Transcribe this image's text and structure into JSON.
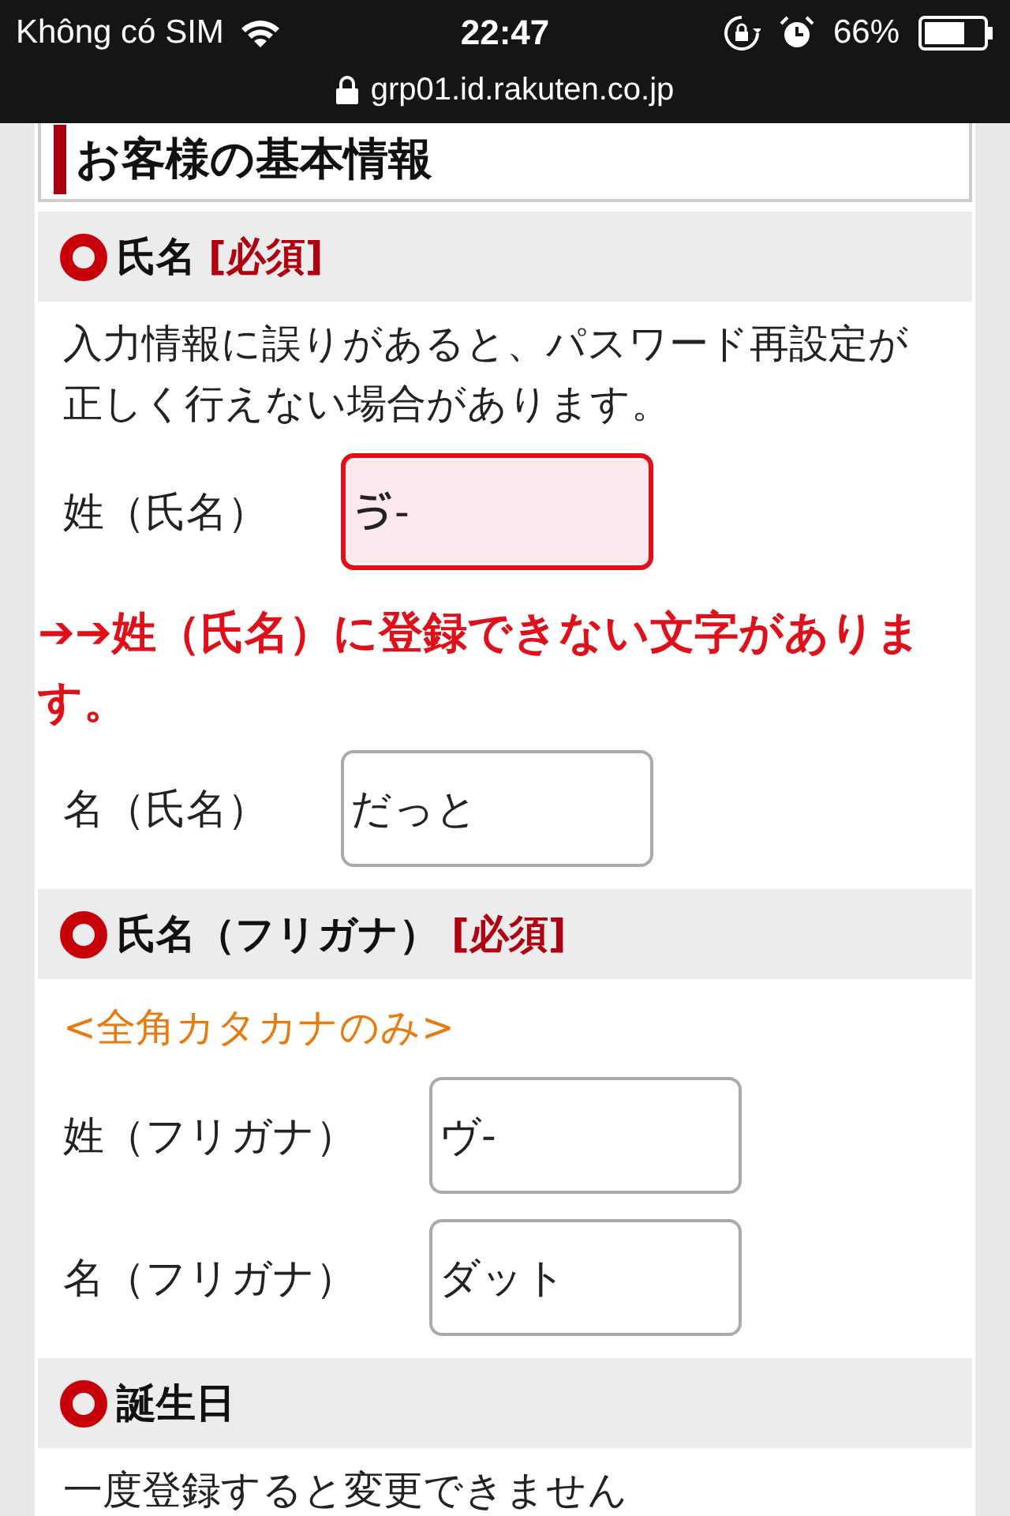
{
  "status_bar": {
    "carrier": "Không có SIM",
    "time": "22:47",
    "battery": "66%"
  },
  "address_bar": {
    "url": "grp01.id.rakuten.co.jp"
  },
  "page_title": "お客様の基本情報",
  "sections": [
    {
      "heading": "氏名",
      "required": "[必須]",
      "note": "入力情報に誤りがあると、パスワード再設定が正しく行えない場合があります。",
      "kind": "plain",
      "fields": [
        {
          "label": "姓（氏名）",
          "value": "ゔ-",
          "invalid": true,
          "error": "➔➔姓（氏名）に登録できない文字があります。"
        },
        {
          "label": "名（氏名）",
          "value": "だっと",
          "invalid": false
        }
      ]
    },
    {
      "heading": "氏名（フリガナ）",
      "required": "[必須]",
      "note": "<全角カタカナのみ>",
      "kind": "hint",
      "fields": [
        {
          "label": "姓（フリガナ）",
          "value": "ヴ-",
          "invalid": false
        },
        {
          "label": "名（フリガナ）",
          "value": "ダット",
          "invalid": false
        }
      ]
    },
    {
      "heading": "誕生日",
      "note": "一度登録すると変更できません",
      "kind": "plain"
    }
  ]
}
